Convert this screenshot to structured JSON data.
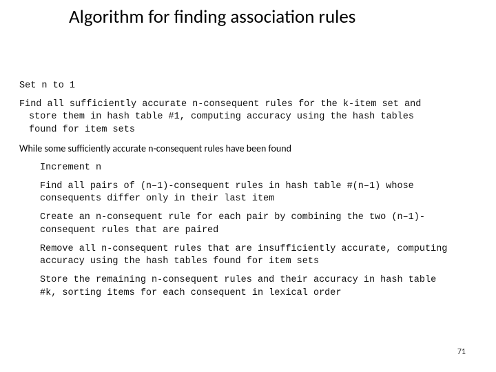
{
  "title": "Algorithm for finding association rules",
  "algo": {
    "step1": "Set n to 1",
    "step2_line1": "Find all sufficiently accurate n-consequent rules for the k-item set and",
    "step2_line2": "store them in hash table #1, computing accuracy using the hash tables",
    "step2_line3": "found for item sets",
    "while_cond": "While some sufficiently accurate n-consequent rules have been found",
    "inc": "Increment n",
    "find_line1": "Find all pairs of (n–1)-consequent rules in hash table #(n–1) whose",
    "find_line2": "consequents differ only in their last item",
    "create_line1": "Create an n-consequent rule for each pair by combining the two (n–1)-",
    "create_line2": "consequent rules that are paired",
    "remove_line1": "Remove all n-consequent rules that are insufficiently accurate, computing",
    "remove_line2": "accuracy using the hash tables found for item sets",
    "store_line1": "Store the remaining n-consequent rules and their accuracy in hash table",
    "store_line2": "#k, sorting items for each consequent in lexical order"
  },
  "page_number": "71"
}
